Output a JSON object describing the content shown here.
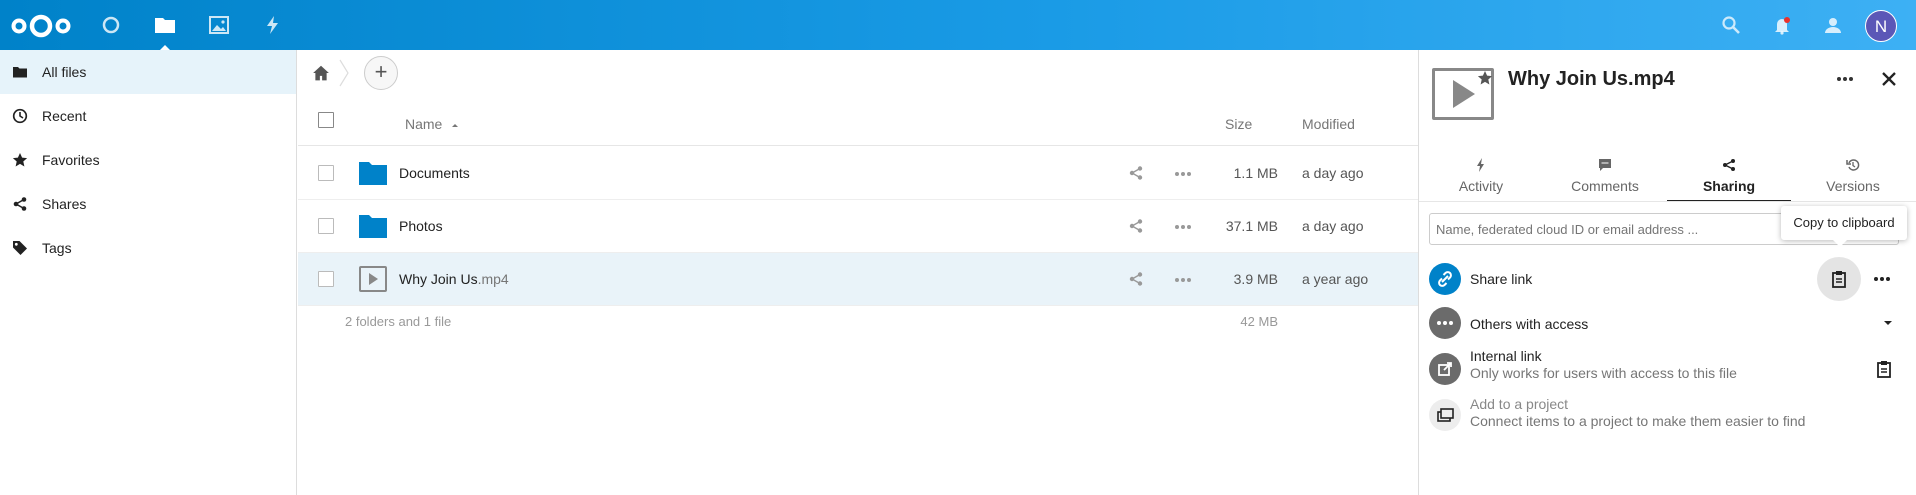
{
  "header": {
    "apps": [
      {
        "name": "dashboard",
        "icon": "circle-icon"
      },
      {
        "name": "files",
        "icon": "folder-icon",
        "active": true
      },
      {
        "name": "photos",
        "icon": "image-icon"
      },
      {
        "name": "activity",
        "icon": "lightning-icon"
      }
    ],
    "avatar_initial": "N",
    "brand_color": "#0082c9"
  },
  "nav": {
    "items": [
      {
        "label": "All files",
        "icon": "folder-icon",
        "active": true
      },
      {
        "label": "Recent",
        "icon": "clock-icon"
      },
      {
        "label": "Favorites",
        "icon": "star-icon"
      },
      {
        "label": "Shares",
        "icon": "share-icon"
      },
      {
        "label": "Tags",
        "icon": "tag-icon"
      }
    ]
  },
  "files": {
    "columns": {
      "name": "Name",
      "size": "Size",
      "modified": "Modified"
    },
    "rows": [
      {
        "name": "Documents",
        "ext": "",
        "type": "folder",
        "size": "1.1 MB",
        "modified": "a day ago"
      },
      {
        "name": "Photos",
        "ext": "",
        "type": "folder",
        "size": "37.1 MB",
        "modified": "a day ago"
      },
      {
        "name": "Why Join Us",
        "ext": ".mp4",
        "type": "video",
        "size": "3.9 MB",
        "modified": "a year ago",
        "selected": true
      }
    ],
    "summary": {
      "count": "2 folders and 1 file",
      "total_size": "42 MB"
    }
  },
  "sidebar": {
    "title": "Why Join Us.mp4",
    "tabs": [
      {
        "label": "Activity",
        "icon": "lightning-icon"
      },
      {
        "label": "Comments",
        "icon": "comment-icon"
      },
      {
        "label": "Sharing",
        "icon": "share-icon",
        "active": true
      },
      {
        "label": "Versions",
        "icon": "history-icon"
      }
    ],
    "share_input_placeholder": "Name, federated cloud ID or email address ...",
    "tooltip": "Copy to clipboard",
    "share_link": {
      "title": "Share link"
    },
    "others": {
      "title": "Others with access"
    },
    "internal": {
      "title": "Internal link",
      "subtitle": "Only works for users with access to this file"
    },
    "project": {
      "title": "Add to a project",
      "subtitle": "Connect items to a project to make them easier to find"
    }
  }
}
